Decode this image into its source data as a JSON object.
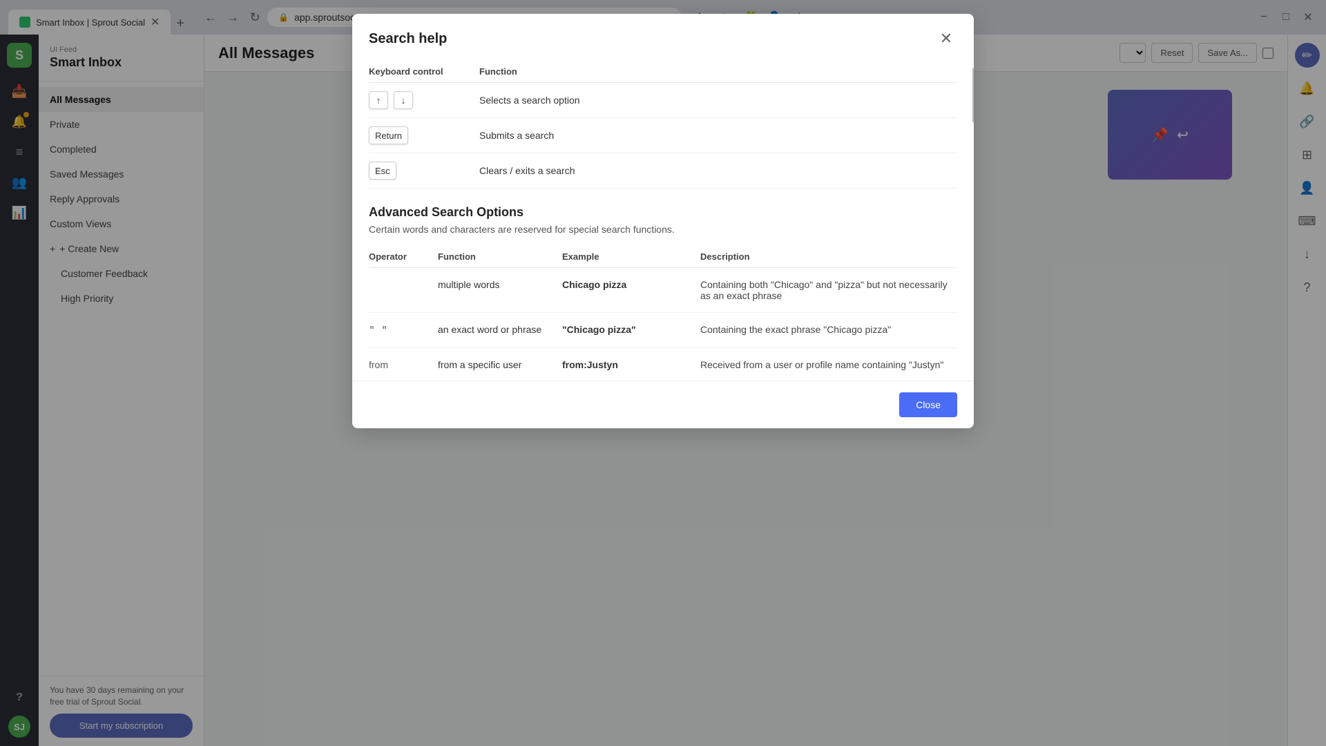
{
  "browser": {
    "tab_title": "Smart Inbox | Sprout Social",
    "url": "app.sproutsocial.com/messages/smart",
    "new_tab_label": "+",
    "nav_back": "←",
    "nav_forward": "→",
    "nav_refresh": "↻",
    "window_minimize": "−",
    "window_maximize": "□",
    "window_close": "✕"
  },
  "app": {
    "logo_text": "S",
    "breadcrumb": "UI Feed",
    "title": "Smart Inbox",
    "rail_icons": [
      {
        "name": "inbox-icon",
        "symbol": "✉",
        "active": true
      },
      {
        "name": "notification-icon",
        "symbol": "🔔",
        "badge": true
      },
      {
        "name": "feed-icon",
        "symbol": "≡"
      },
      {
        "name": "people-icon",
        "symbol": "👤"
      },
      {
        "name": "chart-icon",
        "symbol": "📊"
      },
      {
        "name": "help-icon",
        "symbol": "?"
      }
    ]
  },
  "sidebar": {
    "breadcrumb": "UI Feed",
    "title": "Smart Inbox",
    "nav_items": [
      {
        "label": "All Messages",
        "active": true
      },
      {
        "label": "Private"
      },
      {
        "label": "Completed"
      },
      {
        "label": "Saved Messages"
      },
      {
        "label": "Reply Approvals"
      },
      {
        "label": "Custom Views"
      }
    ],
    "create_new_label": "+ Create New",
    "custom_views": [
      {
        "label": "Customer Feedback"
      },
      {
        "label": "High Priority"
      }
    ],
    "trial_text": "You have 30 days remaining on your free trial of Sprout Social.",
    "trial_btn_label": "Start my subscription"
  },
  "main": {
    "title": "All Messages",
    "reset_label": "Reset",
    "save_as_label": "Save As..."
  },
  "right_panel": {
    "compose_icon": "✏",
    "filter_icon": "⊞",
    "download_icon": "↓",
    "people_icon": "👥",
    "keyboard_icon": "⌨",
    "help_icon": "?"
  },
  "modal": {
    "title": "Search help",
    "close_icon": "✕",
    "keyboard_section": {
      "col_keyboard": "Keyboard control",
      "col_function": "Function",
      "rows": [
        {
          "keys": [
            "↑",
            "↓"
          ],
          "function": "Selects a search option"
        },
        {
          "keys": [
            "Return"
          ],
          "function": "Submits a search"
        },
        {
          "keys": [
            "Esc"
          ],
          "function": "Clears / exits a search"
        }
      ]
    },
    "advanced_section": {
      "title": "Advanced Search Options",
      "subtitle": "Certain words and characters are reserved for special search functions.",
      "col_operator": "Operator",
      "col_function": "Function",
      "col_example": "Example",
      "col_description": "Description",
      "rows": [
        {
          "operator": "",
          "function": "multiple words",
          "example": "Chicago pizza",
          "description": "Containing both \"Chicago\" and \"pizza\" but not necessarily as an exact phrase"
        },
        {
          "operator": "\" \"",
          "function": "an exact word or phrase",
          "example": "\"Chicago pizza\"",
          "description": "Containing the exact phrase \"Chicago pizza\""
        },
        {
          "operator": "from",
          "function": "from a specific user",
          "example": "from:Justyn",
          "description": "Received from a user or profile name containing \"Justyn\""
        }
      ]
    },
    "close_btn_label": "Close"
  }
}
